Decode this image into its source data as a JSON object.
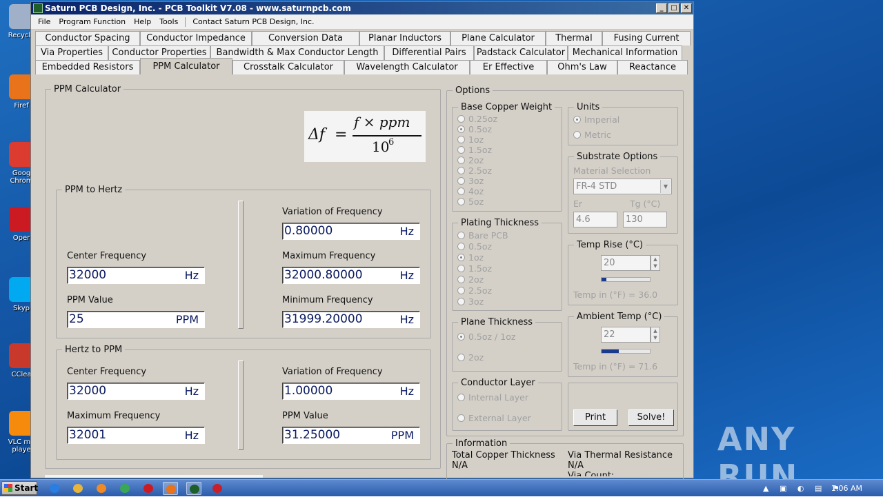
{
  "desktop": {
    "icons": [
      {
        "label": "Recycle",
        "color": "#9fb0c8"
      },
      {
        "label": "Firef",
        "color": "#e8731a"
      },
      {
        "label": "Goog Chrom",
        "color": "#dc3b2f"
      },
      {
        "label": "Oper",
        "color": "#cc1a22"
      },
      {
        "label": "Skyp",
        "color": "#00a9f0"
      },
      {
        "label": "CClea",
        "color": "#c8392c"
      },
      {
        "label": "VLC me playe",
        "color": "#f58a0c"
      }
    ],
    "watermark": "ANY RUN"
  },
  "window": {
    "title": "Saturn PCB Design, Inc. - PCB Toolkit V7.08 - www.saturnpcb.com",
    "controls": [
      "_",
      "□",
      "✕"
    ],
    "menu": [
      "File",
      "Program Function",
      "Help",
      "Tools",
      "Contact Saturn PCB Design, Inc."
    ]
  },
  "tabs": {
    "row1": [
      "Conductor Spacing",
      "Conductor Impedance",
      "Conversion Data",
      "Planar Inductors",
      "Plane Calculator",
      "Thermal",
      "Fusing Current"
    ],
    "row2": [
      "Via Properties",
      "Conductor Properties",
      "Bandwidth & Max Conductor Length",
      "Differential Pairs",
      "Padstack Calculator",
      "Mechanical Information"
    ],
    "row3": [
      "Embedded Resistors",
      "PPM Calculator",
      "Crosstalk Calculator",
      "Wavelength Calculator",
      "Er Effective",
      "Ohm's Law",
      "Reactance"
    ],
    "active": "PPM Calculator"
  },
  "ppm": {
    "title": "PPM Calculator",
    "formula": {
      "lhs": "Δf",
      "eq": "=",
      "numerator": "f × ppm",
      "denominator": "10",
      "exponent": "6"
    },
    "ppm_to_hz": {
      "title": "PPM to Hertz",
      "center_label": "Center Frequency",
      "center_value": "32000",
      "center_unit": "Hz",
      "ppm_label": "PPM Value",
      "ppm_value": "25",
      "ppm_unit": "PPM",
      "var_label": "Variation of Frequency",
      "var_value": "0.80000",
      "var_unit": "Hz",
      "max_label": "Maximum Frequency",
      "max_value": "32000.80000",
      "max_unit": "Hz",
      "min_label": "Minimum Frequency",
      "min_value": "31999.20000",
      "min_unit": "Hz"
    },
    "hz_to_ppm": {
      "title": "Hertz to PPM",
      "center_label": "Center Frequency",
      "center_value": "32000",
      "center_unit": "Hz",
      "max_label": "Maximum Frequency",
      "max_value": "32001",
      "max_unit": "Hz",
      "var_label": "Variation of Frequency",
      "var_value": "1.00000",
      "var_unit": "Hz",
      "ppm_label": "PPM Value",
      "ppm_value": "31.25000",
      "ppm_unit": "PPM"
    }
  },
  "options": {
    "title": "Options",
    "base_copper": {
      "title": "Base Copper Weight",
      "items": [
        "0.25oz",
        "0.5oz",
        "1oz",
        "1.5oz",
        "2oz",
        "2.5oz",
        "3oz",
        "4oz",
        "5oz"
      ],
      "selected": "0.5oz"
    },
    "plating": {
      "title": "Plating Thickness",
      "items": [
        "Bare PCB",
        "0.5oz",
        "1oz",
        "1.5oz",
        "2oz",
        "2.5oz",
        "3oz"
      ],
      "selected": "1oz"
    },
    "plane": {
      "title": "Plane Thickness",
      "items": [
        "0.5oz / 1oz",
        "2oz"
      ],
      "selected": "0.5oz / 1oz"
    },
    "conductor_layer": {
      "title": "Conductor Layer",
      "items": [
        "Internal Layer",
        "External Layer"
      ]
    },
    "units": {
      "title": "Units",
      "items": [
        "Imperial",
        "Metric"
      ],
      "selected": "Imperial"
    },
    "substrate": {
      "title": "Substrate Options",
      "material_label": "Material Selection",
      "material_value": "FR-4 STD",
      "er_label": "Er",
      "er_value": "4.6",
      "tg_label": "Tg (°C)",
      "tg_value": "130"
    },
    "temp_rise": {
      "title": "Temp Rise (°C)",
      "value": "20",
      "level": 0.1,
      "readout": "Temp in (°F) = 36.0"
    },
    "ambient": {
      "title": "Ambient Temp (°C)",
      "value": "22",
      "level": 0.35,
      "readout": "Temp in (°F) = 71.6"
    },
    "print_label": "Print",
    "solve_label": "Solve!"
  },
  "information": {
    "title": "Information",
    "copper_label": "Total Copper Thickness",
    "copper_value": "N/A",
    "via_label": "Via Thermal Resistance",
    "via_value": "N/A",
    "via_count_label": "Via Count:"
  },
  "taskbar": {
    "start": "Start",
    "time": "1:06 AM",
    "apps": [
      {
        "name": "ie",
        "color": "#2a7de1"
      },
      {
        "name": "explorer",
        "color": "#e8b53a"
      },
      {
        "name": "media",
        "color": "#f08a24"
      },
      {
        "name": "chrome",
        "color": "#3aa757"
      },
      {
        "name": "opera",
        "color": "#cc1a22"
      },
      {
        "name": "firefox",
        "color": "#e8731a"
      },
      {
        "name": "pcbtoolkit",
        "color": "#1d5e2a"
      },
      {
        "name": "acrobat",
        "color": "#c8202a"
      }
    ]
  }
}
